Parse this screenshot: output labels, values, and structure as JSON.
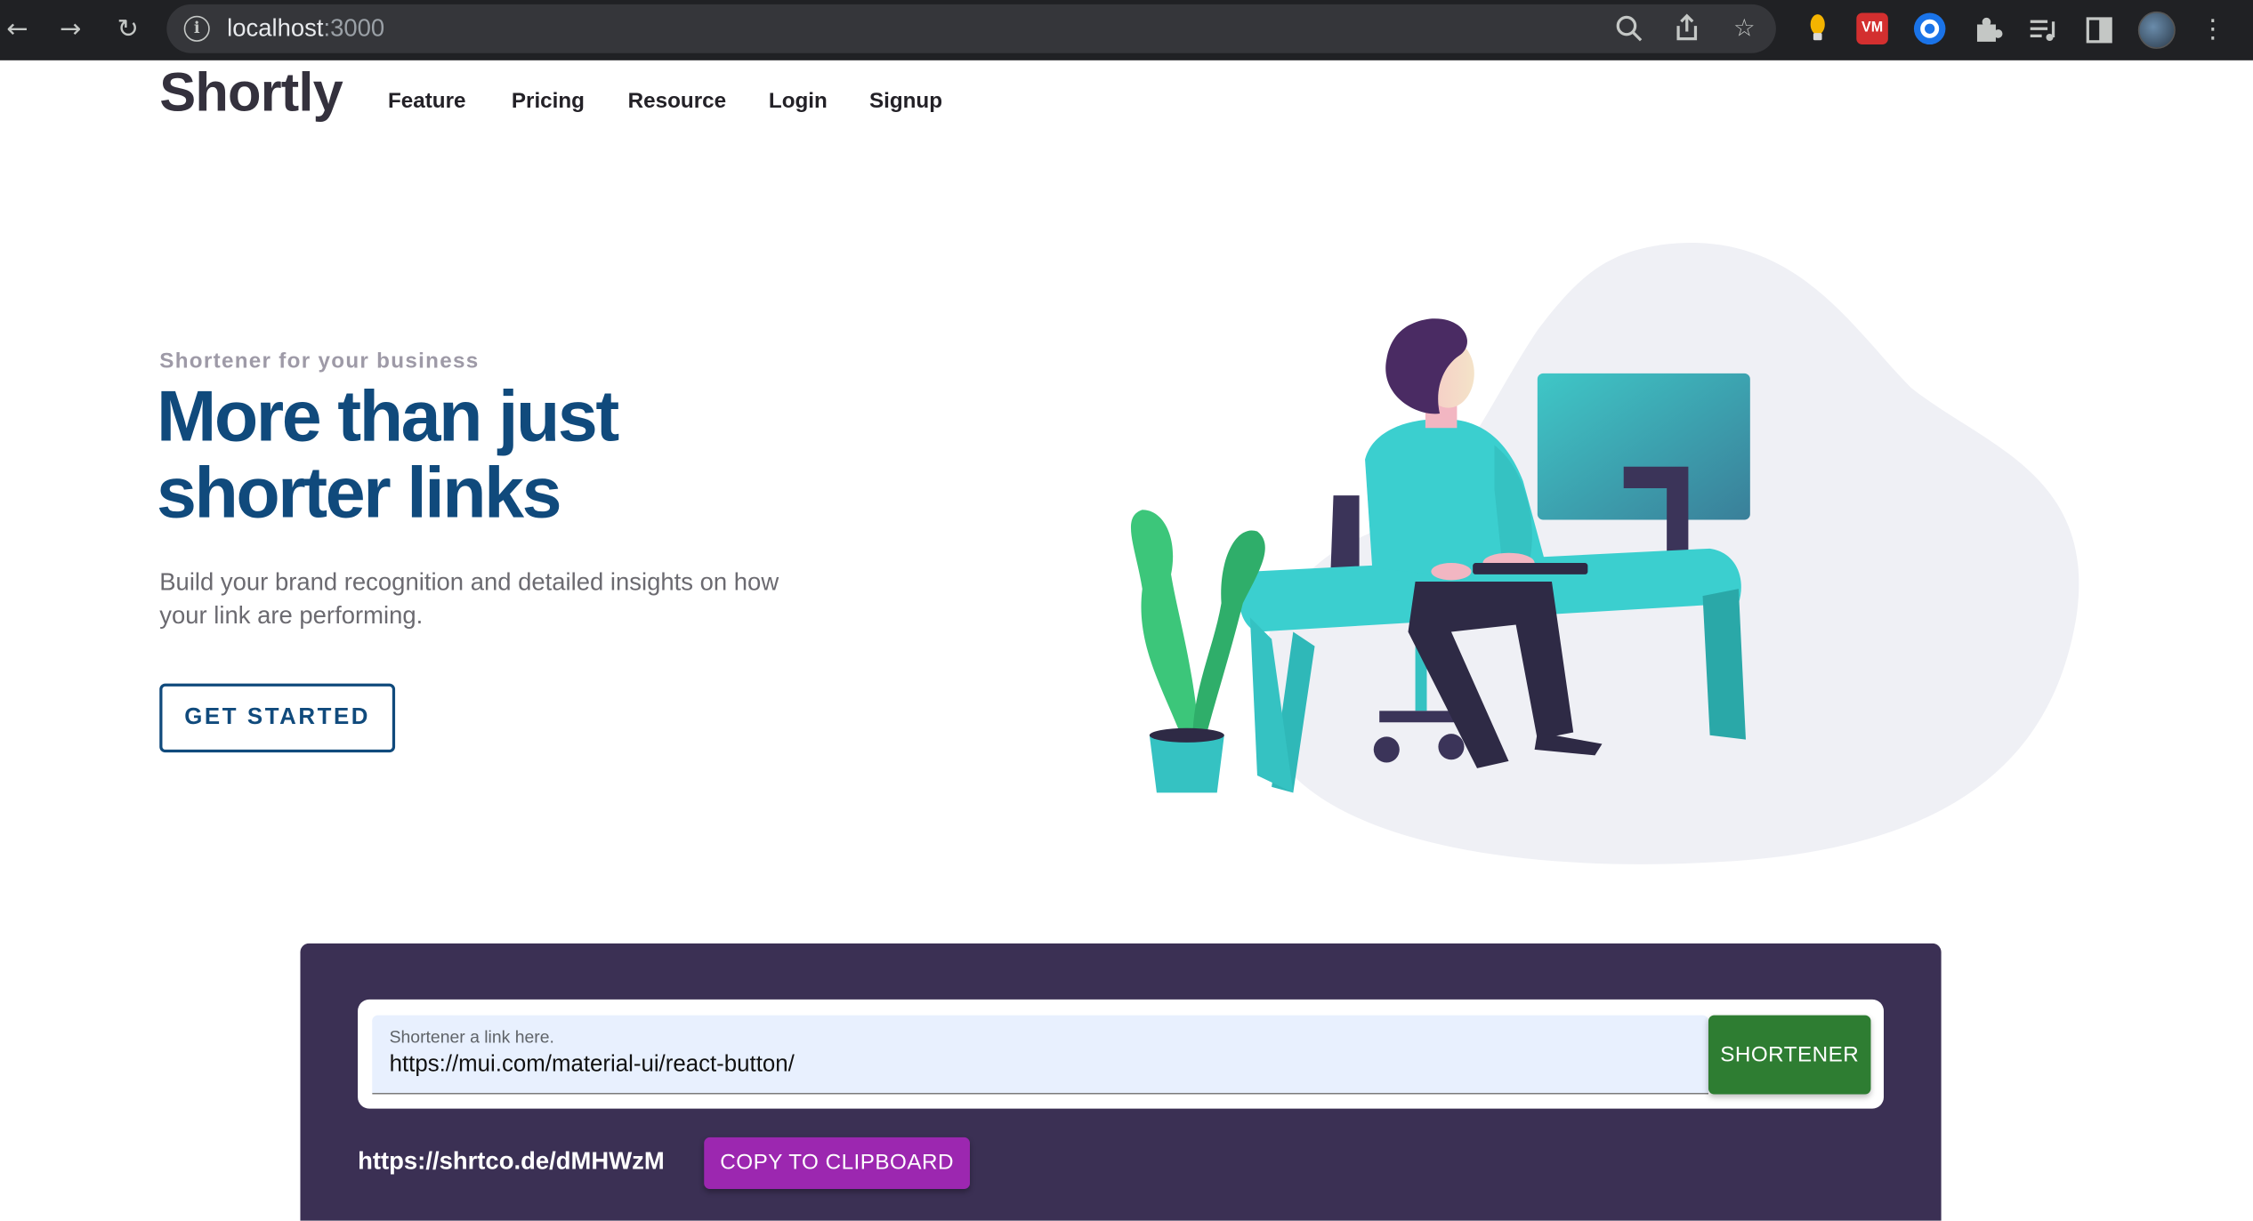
{
  "browser": {
    "url_host": "localhost",
    "url_port": ":3000",
    "icons": [
      "back-icon",
      "forward-icon",
      "reload-icon",
      "info-icon",
      "zoom-icon",
      "share-icon",
      "bookmark-star-icon",
      "extension-icon",
      "puzzle-icon",
      "media-icon",
      "sidepanel-icon",
      "menu-icon"
    ]
  },
  "nav": {
    "logo": "Shortly",
    "links": [
      "Feature",
      "Pricing",
      "Resource",
      "Login",
      "Signup"
    ]
  },
  "hero": {
    "eyebrow": "Shortener for your business",
    "headline_line1": "More than just",
    "headline_line2": "shorter links",
    "lead": "Build your brand recognition and detailed insights on how your link are performing.",
    "cta": "GET STARTED"
  },
  "shortener": {
    "field_label": "Shortener a link here.",
    "field_value": "https://mui.com/material-ui/react-button/",
    "submit_label": "SHORTENER",
    "result_url": "https://shrtco.de/dMHWzM",
    "copy_label": "COPY TO CLIPBOARD"
  },
  "colors": {
    "brand_navy": "#104a7c",
    "panel_purple": "#3b3054",
    "shorten_green": "#2e7d32",
    "copy_purple": "#9c27b0",
    "illustration_teal": "#3bcfcf"
  }
}
